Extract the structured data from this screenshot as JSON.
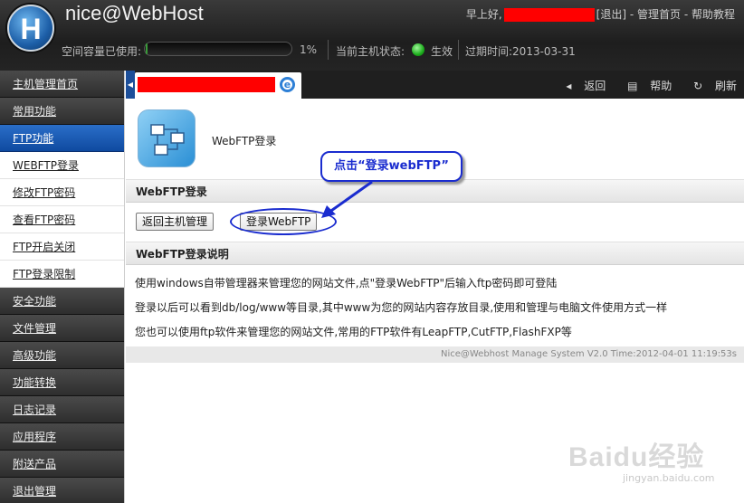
{
  "header": {
    "brand": "nice@WebHost",
    "logo_letter": "H",
    "greeting": "早上好,",
    "logout": "[退出]",
    "separator": " - ",
    "home_link": "管理首页",
    "help_link": "帮助教程",
    "usage_label": "空间容量已使用:",
    "usage_percent": "1%",
    "usage_fraction": 0.01,
    "status_label": "当前主机状态:",
    "status_value": "生效",
    "expire": "过期时间:2013-03-31"
  },
  "sidebar": {
    "items": [
      {
        "label": "主机管理首页",
        "kind": "group"
      },
      {
        "label": "常用功能",
        "kind": "group"
      },
      {
        "label": "FTP功能",
        "kind": "active"
      },
      {
        "label": "WEBFTP登录",
        "kind": "sub"
      },
      {
        "label": "修改FTP密码",
        "kind": "sub"
      },
      {
        "label": "查看FTP密码",
        "kind": "sub"
      },
      {
        "label": "FTP开启关闭",
        "kind": "sub"
      },
      {
        "label": "FTP登录限制",
        "kind": "sub"
      },
      {
        "label": "安全功能",
        "kind": "group"
      },
      {
        "label": "文件管理",
        "kind": "group"
      },
      {
        "label": "高级功能",
        "kind": "group"
      },
      {
        "label": "功能转换",
        "kind": "group"
      },
      {
        "label": "日志记录",
        "kind": "group"
      },
      {
        "label": "应用程序",
        "kind": "group"
      },
      {
        "label": "附送产品",
        "kind": "group"
      },
      {
        "label": "退出管理",
        "kind": "group"
      }
    ]
  },
  "tabbar": {
    "back": "返回",
    "help": "帮助",
    "refresh": "刷新"
  },
  "content": {
    "module_title": "WebFTP登录",
    "section_login": "WebFTP登录",
    "back_button": "返回主机管理",
    "login_button": "登录WebFTP",
    "callout": "点击“登录webFTP”",
    "section_desc": "WebFTP登录说明",
    "desc_lines": [
      "使用windows自带管理器来管理您的网站文件,点\"登录WebFTP\"后输入ftp密码即可登陆",
      "登录以后可以看到db/log/www等目录,其中www为您的网站内容存放目录,使用和管理与电脑文件使用方式一样",
      "您也可以使用ftp软件来管理您的网站文件,常用的FTP软件有LeapFTP,CutFTP,FlashFXP等"
    ],
    "footer": "Nice@Webhost Manage System V2.0 Time:2012-04-01 11:19:53s"
  },
  "watermark": {
    "main": "Baidu经验",
    "sub": "jingyan.baidu.com"
  },
  "colors": {
    "accent_blue": "#1a2ccf",
    "redaction": "#ff0000",
    "status_green": "#1cae1c"
  }
}
